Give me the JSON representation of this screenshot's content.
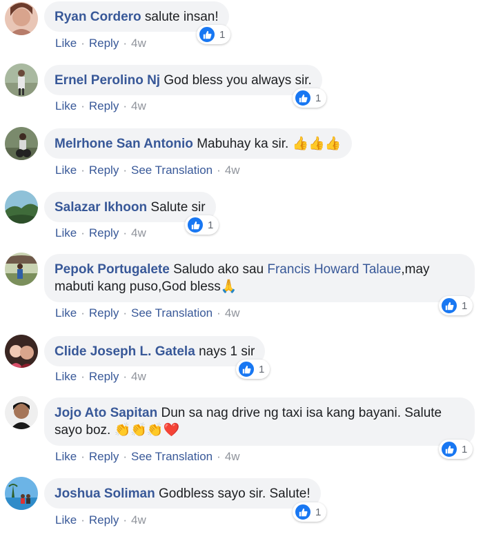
{
  "comments": [
    {
      "author": "Ryan Cordero",
      "text": "salute insan!",
      "actions": [
        "Like",
        "Reply"
      ],
      "time": "4w",
      "reactions": "1"
    },
    {
      "author": "Ernel Perolino Nj",
      "text": "God bless you always sir.",
      "actions": [
        "Like",
        "Reply"
      ],
      "time": "4w",
      "reactions": "1"
    },
    {
      "author": "Melrhone San Antonio",
      "text": "Mabuhay ka sir. ",
      "emoji": "👍👍👍",
      "actions": [
        "Like",
        "Reply",
        "See Translation"
      ],
      "time": "4w"
    },
    {
      "author": "Salazar Ikhoon",
      "text": "Salute sir",
      "actions": [
        "Like",
        "Reply"
      ],
      "time": "4w",
      "reactions": "1"
    },
    {
      "author": "Pepok Portugalete",
      "text_before": "Saludo ako sau ",
      "mention": "Francis Howard Talaue",
      "text_after": ",may",
      "text_line2": "mabuti kang puso,God bless",
      "emoji": "🙏",
      "actions": [
        "Like",
        "Reply",
        "See Translation"
      ],
      "time": "4w",
      "reactions": "1"
    },
    {
      "author": "Clide Joseph L. Gatela",
      "text": "nays 1 sir",
      "actions": [
        "Like",
        "Reply"
      ],
      "time": "4w",
      "reactions": "1"
    },
    {
      "author": "Jojo Ato Sapitan",
      "text": "Dun sa nag drive ng taxi isa kang bayani. Salute",
      "text_line2": "sayo boz. ",
      "emoji": "👏👏👏❤️",
      "actions": [
        "Like",
        "Reply",
        "See Translation"
      ],
      "time": "4w",
      "reactions": "1"
    },
    {
      "author": "Joshua Soliman",
      "text": "Godbless sayo sir. Salute!",
      "actions": [
        "Like",
        "Reply"
      ],
      "time": "4w",
      "reactions": "1"
    }
  ],
  "separator": "·",
  "colors": {
    "link": "#385898",
    "bubble": "#f2f3f5",
    "like_blue": "#1877f2",
    "meta": "#90949c"
  },
  "icons": {
    "reaction": "like-thumb-icon"
  }
}
